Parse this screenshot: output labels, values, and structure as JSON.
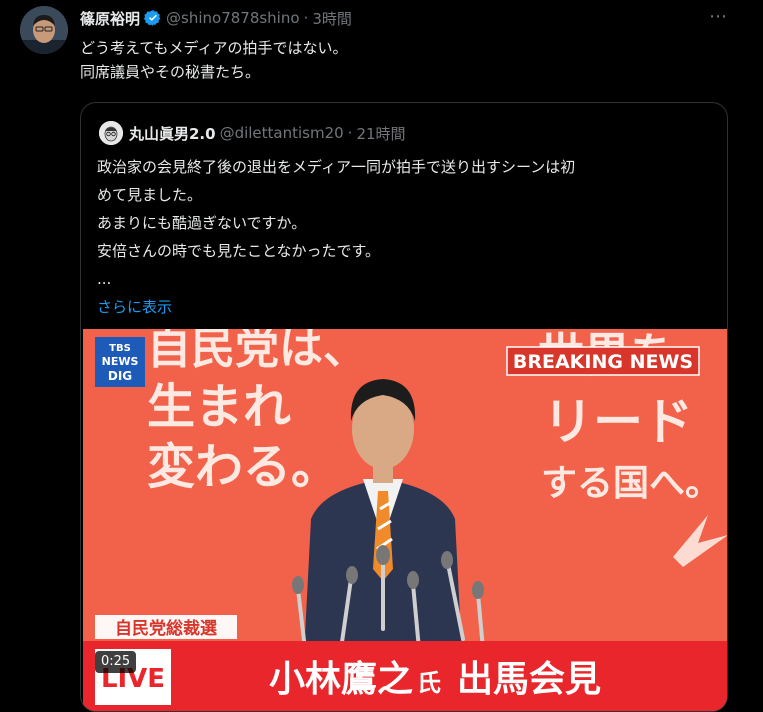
{
  "post": {
    "author_name": "篠原裕明",
    "handle": "@shino7878shino",
    "separator": "·",
    "time": "3時間",
    "more_label": "⋯",
    "lines": [
      "どう考えてもメディアの拍手ではない。",
      "同席議員やその秘書たち。"
    ]
  },
  "quote": {
    "author_name": "丸山眞男2.0",
    "handle": "@dilettantism20",
    "separator": "·",
    "time": "21時間",
    "lines": [
      "政治家の会見終了後の退出をメディア一同が拍手で送り出すシーンは初",
      "めて見ました。",
      "あまりにも酷過ぎないですか。",
      "安倍さんの時でも見たことなかったです。",
      "..."
    ],
    "show_more": "さらに表示"
  },
  "video": {
    "logo_line1": "TBS",
    "logo_line2": "NEWS",
    "logo_line3": "DIG",
    "breaking": "BREAKING NEWS",
    "bg_left_1": "自民党は、",
    "bg_left_2": "生まれ",
    "bg_left_3": "変わる。",
    "bg_right_1": "世界を",
    "bg_right_2": "リード",
    "bg_right_3": "する国へ。",
    "tag": "自民党総裁選",
    "live": "LIVE",
    "headline_name": "小林鷹之",
    "headline_suffix": "氏",
    "headline_event": "出馬会見",
    "duration": "0:25"
  },
  "colors": {
    "background": "#000000",
    "text": "#e7e9ea",
    "muted": "#71767b",
    "link": "#1d9bf0",
    "verified": "#1d9bf0",
    "video_bg": "#f2624a",
    "banner_red": "#e8262b"
  },
  "icons": [
    "verified-badge-icon",
    "more-options-icon"
  ]
}
